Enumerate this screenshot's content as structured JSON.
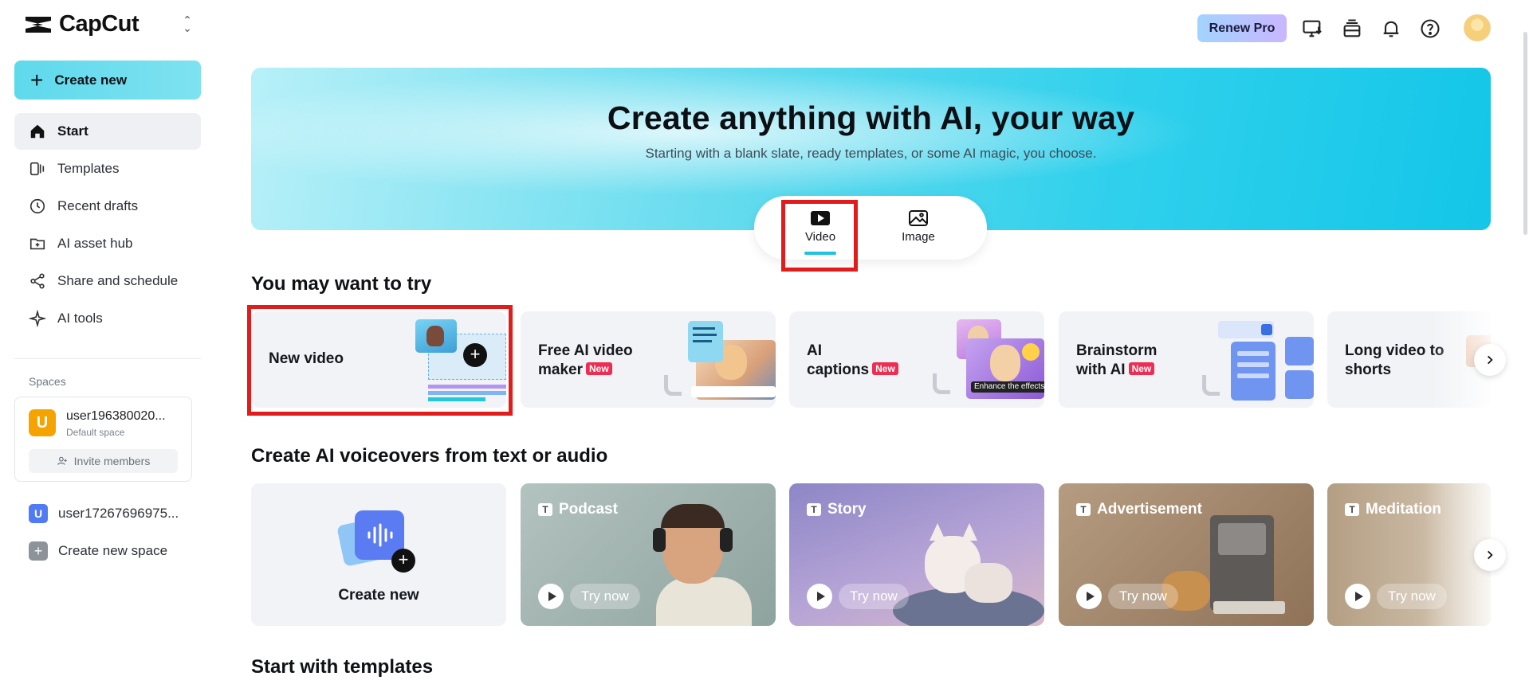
{
  "app": {
    "name": "CapCut"
  },
  "sidebar": {
    "create_label": "Create new",
    "items": [
      {
        "label": "Start",
        "icon": "home-icon"
      },
      {
        "label": "Templates",
        "icon": "templates-icon"
      },
      {
        "label": "Recent drafts",
        "icon": "clock-icon"
      },
      {
        "label": "AI asset hub",
        "icon": "folder-icon"
      },
      {
        "label": "Share and schedule",
        "icon": "share-icon"
      },
      {
        "label": "AI tools",
        "icon": "sparkle-icon"
      }
    ],
    "spaces_label": "Spaces",
    "current_space": {
      "initial": "U",
      "name": "user196380020...",
      "subtitle": "Default space",
      "invite_label": "Invite members"
    },
    "other_space": {
      "initial": "U",
      "name": "user17267696975..."
    },
    "new_space_label": "Create new space"
  },
  "topbar": {
    "renew_label": "Renew Pro"
  },
  "hero": {
    "title": "Create anything with AI, your way",
    "subtitle": "Starting with a blank slate, ready templates, or some AI magic, you choose.",
    "modes": [
      {
        "label": "Video",
        "active": true
      },
      {
        "label": "Image",
        "active": false
      }
    ]
  },
  "try_section": {
    "title": "You may want to try",
    "cards": [
      {
        "line1": "New video",
        "line2": "",
        "is_new": false
      },
      {
        "line1": "Free AI video",
        "line2": "maker",
        "is_new": true
      },
      {
        "line1": "AI",
        "line2": "captions",
        "is_new": true,
        "overlay_text": "Enhance the effects"
      },
      {
        "line1": "Brainstorm",
        "line2": "with AI",
        "is_new": true
      },
      {
        "line1": "Long video to",
        "line2": "shorts",
        "is_new": false
      }
    ],
    "badge_new": "New"
  },
  "voiceover_section": {
    "title": "Create AI voiceovers from text or audio",
    "create_label": "Create new",
    "cards": [
      {
        "label": "Podcast",
        "cta": "Try now",
        "bg": "#9fb1ad"
      },
      {
        "label": "Story",
        "cta": "Try now",
        "bg": "#9c95c9"
      },
      {
        "label": "Advertisement",
        "cta": "Try now",
        "bg": "#a0866c"
      },
      {
        "label": "Meditation",
        "cta": "Try now",
        "bg": "#b8a489"
      }
    ]
  },
  "templates_section": {
    "title": "Start with templates"
  },
  "colors": {
    "accent": "#1fc3e0",
    "highlight": "#e21b1b",
    "badge": "#ef2c52"
  }
}
